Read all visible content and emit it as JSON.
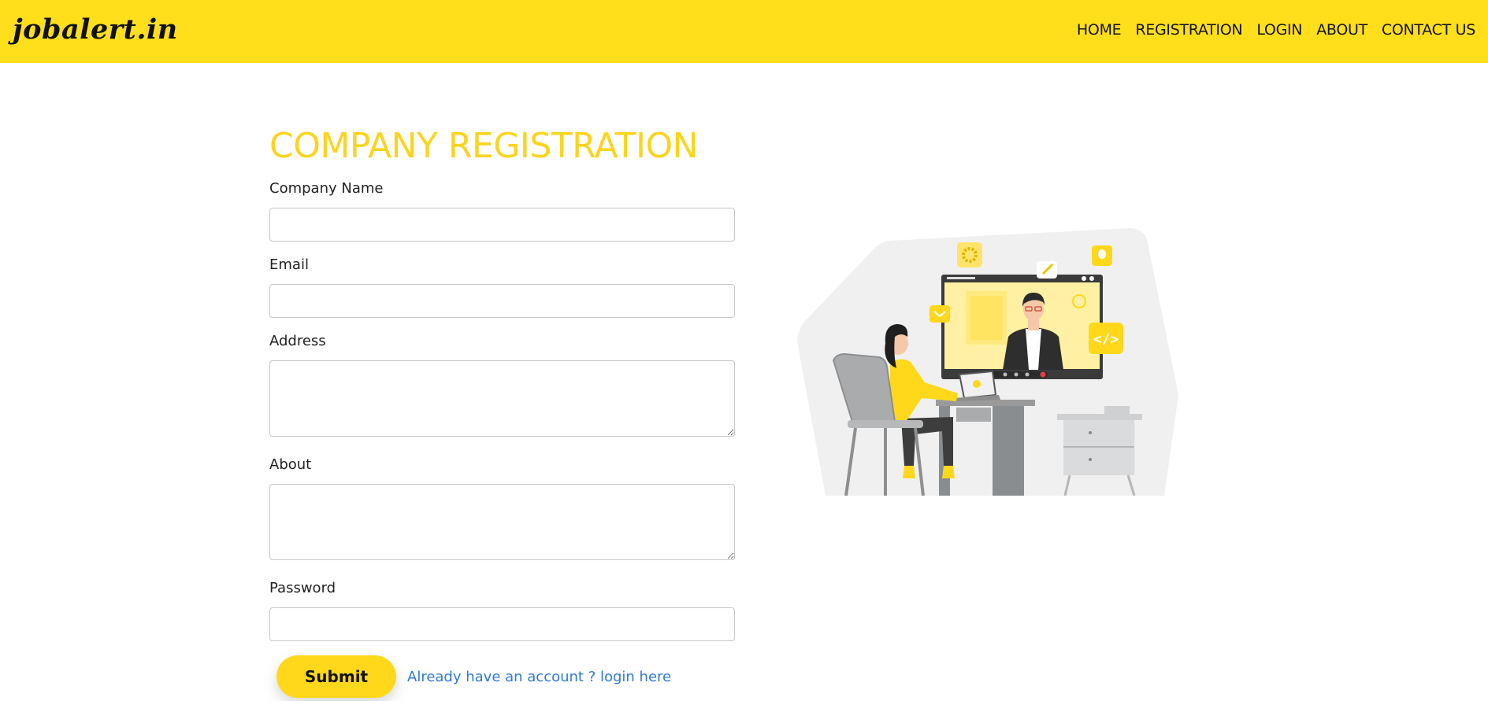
{
  "navbar": {
    "brand": "jobalert.in",
    "links": [
      {
        "label": "HOME"
      },
      {
        "label": "REGISTRATION"
      },
      {
        "label": "LOGIN"
      },
      {
        "label": "ABOUT"
      },
      {
        "label": "CONTACT US"
      }
    ]
  },
  "form": {
    "title": "COMPANY REGISTRATION",
    "fields": {
      "company_name": {
        "label": "Company Name",
        "value": ""
      },
      "email": {
        "label": "Email",
        "value": ""
      },
      "address": {
        "label": "Address",
        "value": ""
      },
      "about": {
        "label": "About",
        "value": ""
      },
      "password": {
        "label": "Password",
        "value": ""
      }
    },
    "submit_label": "Submit",
    "login_link": "Already have an account ? login here"
  },
  "illustration": {
    "icon": "video-interview-illustration"
  },
  "colors": {
    "accent": "#ffde1c",
    "title": "#fbd41d",
    "link": "#2e7ad4"
  }
}
